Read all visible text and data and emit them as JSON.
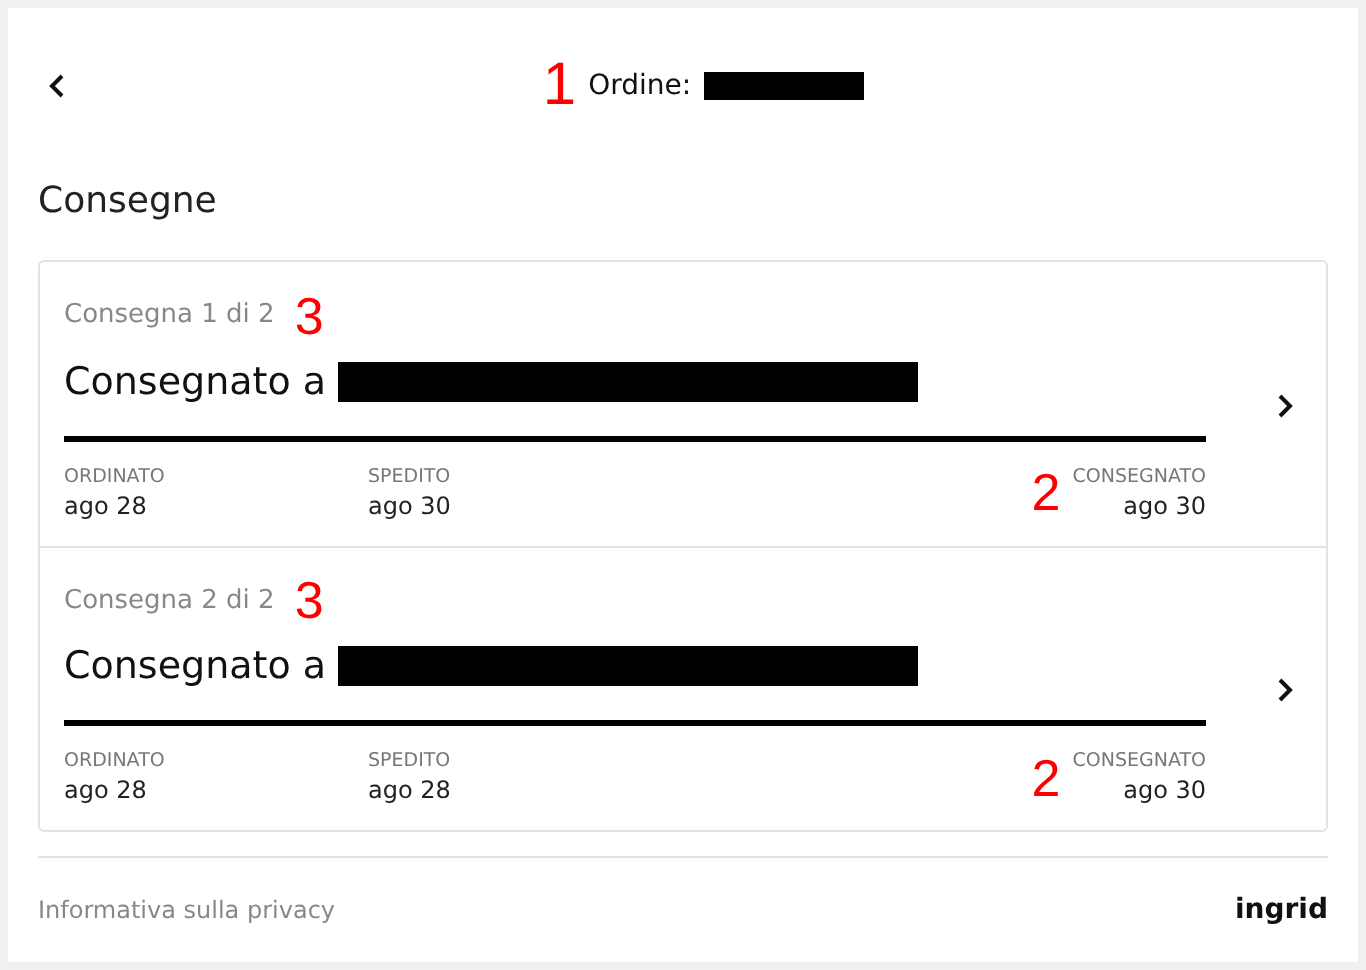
{
  "header": {
    "title": "Ordine:",
    "annotation": "1"
  },
  "section_title": "Consegne",
  "deliveries": [
    {
      "label": "Consegna 1 di 2",
      "annotation": "3",
      "status": "Consegnato a",
      "level": 1,
      "steps_annotation": "2",
      "steps": [
        {
          "label": "ORDINATO",
          "date": "ago 28"
        },
        {
          "label": "SPEDITO",
          "date": "ago 30"
        },
        {
          "label": "CONSEGNATO",
          "date": "ago 30"
        }
      ]
    },
    {
      "label": "Consegna 2 di 2",
      "annotation": "3",
      "status": "Consegnato a",
      "level": 1,
      "steps_annotation": "2",
      "steps": [
        {
          "label": "ORDINATO",
          "date": "ago 28"
        },
        {
          "label": "SPEDITO",
          "date": "ago 28"
        },
        {
          "label": "CONSEGNATO",
          "date": "ago 30"
        }
      ]
    }
  ],
  "footer": {
    "link": "Informativa sulla privacy",
    "logo": "ingrid"
  }
}
